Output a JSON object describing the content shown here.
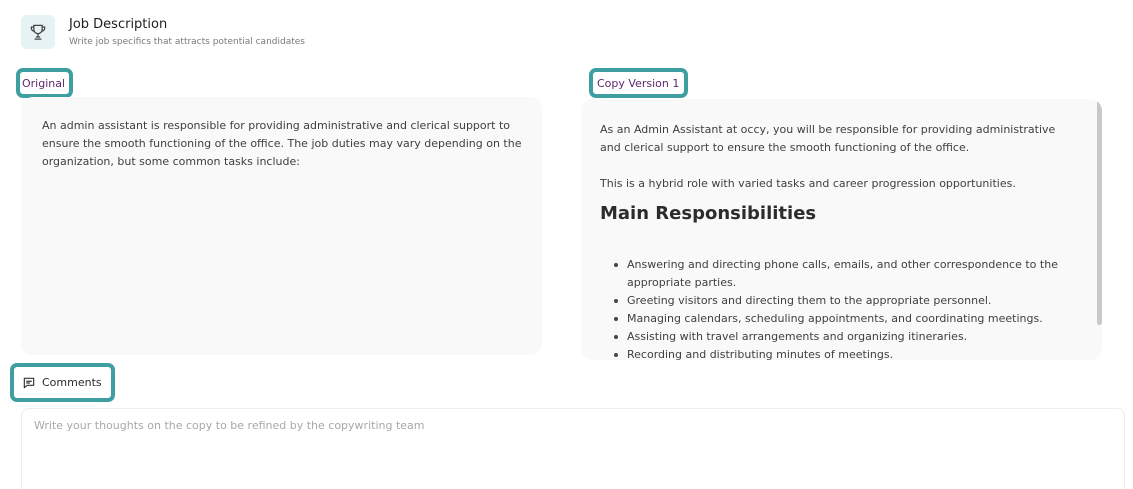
{
  "header": {
    "icon": "trophy-icon",
    "title": "Job Description",
    "subtitle": "Write job specifics that attracts potential candidates"
  },
  "original": {
    "label": "Original",
    "text": "An admin assistant is responsible for providing administrative and clerical support to ensure the smooth functioning of the office. The job duties may vary depending on the organization, but some common tasks include:"
  },
  "copy": {
    "label": "Copy Version 1",
    "paragraph1": "As an Admin Assistant at occy, you will be responsible for providing administrative and clerical support to ensure the smooth functioning of the office.",
    "paragraph2": "This is a hybrid role with varied tasks and career progression opportunities.",
    "heading": "Main Responsibilities",
    "items": [
      "Answering and directing phone calls, emails, and other correspondence to the appropriate parties.",
      "Greeting visitors and directing them to the appropriate personnel.",
      "Managing calendars, scheduling appointments, and coordinating meetings.",
      "Assisting with travel arrangements and organizing itineraries.",
      "Recording and distributing minutes of meetings."
    ]
  },
  "comments": {
    "icon": "comment-icon",
    "label": "Comments",
    "placeholder": "Write your thoughts on the copy to be refined by the copywriting team",
    "value": ""
  },
  "colors": {
    "highlight_border": "#3f9e9f",
    "tag_text": "#5b2a6e",
    "panel_bg": "#f9f9f9"
  }
}
